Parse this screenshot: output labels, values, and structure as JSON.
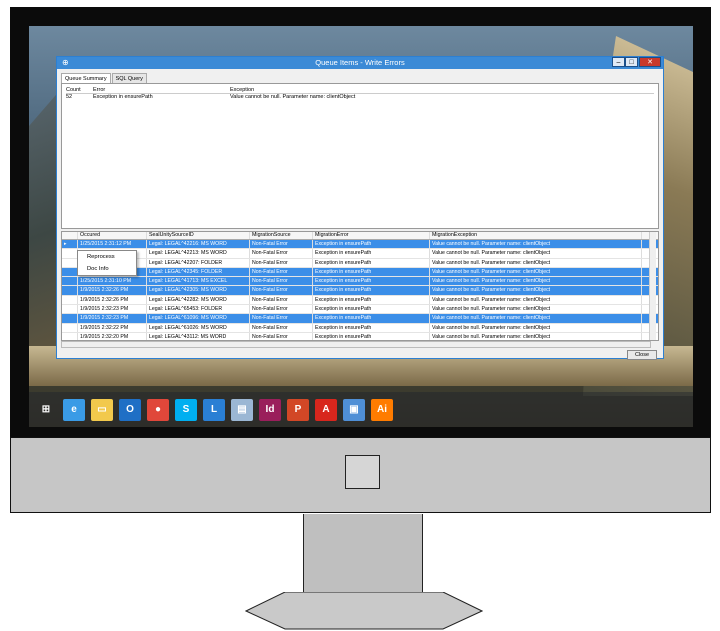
{
  "window": {
    "title": "Queue Items - Write Errors",
    "tabs": [
      "Queue Summary",
      "SQL Query"
    ],
    "close_label": "Close"
  },
  "summary": {
    "headers": [
      "Count",
      "Error",
      "Exception"
    ],
    "rows": [
      [
        "52",
        "Exception in ensurePath",
        "Value cannot be null. Parameter name: clientObject"
      ]
    ]
  },
  "grid": {
    "headers": [
      "Occured",
      "SealUnitySourceID",
      "MigrationSource",
      "MigrationError",
      "MigrationException"
    ],
    "rows": [
      {
        "occured": "1/25/2015 2:31:12 PM",
        "seal": "Legal: LEGAL^42216: MS WORD",
        "source": "Non-Fatal Error",
        "error": "Exception in ensurePath",
        "exception": "Value cannot be null. Parameter name: clientObject",
        "selected": true
      },
      {
        "occured": "1/25/2015 2:31:11 PM",
        "seal": "Legal: LEGAL^42213: MS WORD",
        "source": "Non-Fatal Error",
        "error": "Exception in ensurePath",
        "exception": "Value cannot be null. Parameter name: clientObject",
        "selected": false
      },
      {
        "occured": "1/25/2015 2:31:11 PM",
        "seal": "Legal: LEGAL^42207: FOLDER",
        "source": "Non-Fatal Error",
        "error": "Exception in ensurePath",
        "exception": "Value cannot be null. Parameter name: clientObject",
        "selected": false
      },
      {
        "occured": "1/25/2015 2:31:10 PM",
        "seal": "Legal: LEGAL^42345: FOLDER",
        "source": "Non-Fatal Error",
        "error": "Exception in ensurePath",
        "exception": "Value cannot be null. Parameter name: clientObject",
        "selected": true
      },
      {
        "occured": "1/25/2015 2:31:10 PM",
        "seal": "Legal: LEGAL^41713: MS EXCEL",
        "source": "Non-Fatal Error",
        "error": "Exception in ensurePath",
        "exception": "Value cannot be null. Parameter name: clientObject",
        "selected": true
      },
      {
        "occured": "1/9/2015 2:32:26 PM",
        "seal": "Legal: LEGAL^42305: MS WORD",
        "source": "Non-Fatal Error",
        "error": "Exception in ensurePath",
        "exception": "Value cannot be null. Parameter name: clientObject",
        "selected": true
      },
      {
        "occured": "1/9/2015 2:32:26 PM",
        "seal": "Legal: LEGAL^42282: MS WORD",
        "source": "Non-Fatal Error",
        "error": "Exception in ensurePath",
        "exception": "Value cannot be null. Parameter name: clientObject",
        "selected": false
      },
      {
        "occured": "1/9/2015 2:32:23 PM",
        "seal": "Legal: LEGAL^65453: FOLDER",
        "source": "Non-Fatal Error",
        "error": "Exception in ensurePath",
        "exception": "Value cannot be null. Parameter name: clientObject",
        "selected": false
      },
      {
        "occured": "1/9/2015 2:32:23 PM",
        "seal": "Legal: LEGAL^61096: MS WORD",
        "source": "Non-Fatal Error",
        "error": "Exception in ensurePath",
        "exception": "Value cannot be null. Parameter name: clientObject",
        "selected": true
      },
      {
        "occured": "1/9/2015 2:32:22 PM",
        "seal": "Legal: LEGAL^61026: MS WORD",
        "source": "Non-Fatal Error",
        "error": "Exception in ensurePath",
        "exception": "Value cannot be null. Parameter name: clientObject",
        "selected": false
      },
      {
        "occured": "1/9/2015 2:32:20 PM",
        "seal": "Legal: LEGAL^43112: MS WORD",
        "source": "Non-Fatal Error",
        "error": "Exception in ensurePath",
        "exception": "Value cannot be null. Parameter name: clientObject",
        "selected": false
      }
    ]
  },
  "context_menu": {
    "items": [
      "Reprocess",
      "Doc Info"
    ]
  },
  "taskbar": {
    "icons": [
      {
        "name": "windows-start-icon",
        "glyph": "⊞",
        "color": "#ffffff"
      },
      {
        "name": "internet-explorer-icon",
        "glyph": "e",
        "color": "#3a9be6"
      },
      {
        "name": "file-explorer-icon",
        "glyph": "▭",
        "color": "#f2c94c"
      },
      {
        "name": "outlook-icon",
        "glyph": "O",
        "color": "#1f6fc5"
      },
      {
        "name": "chrome-icon",
        "glyph": "●",
        "color": "#e0473a"
      },
      {
        "name": "skype-icon",
        "glyph": "S",
        "color": "#00aff0"
      },
      {
        "name": "lync-icon",
        "glyph": "L",
        "color": "#2a7fd4"
      },
      {
        "name": "notepad-icon",
        "glyph": "▤",
        "color": "#9bb7d4"
      },
      {
        "name": "indesign-icon",
        "glyph": "Id",
        "color": "#9a1f5b"
      },
      {
        "name": "powerpoint-icon",
        "glyph": "P",
        "color": "#d24726"
      },
      {
        "name": "acrobat-icon",
        "glyph": "A",
        "color": "#d8261d"
      },
      {
        "name": "remote-desktop-icon",
        "glyph": "▣",
        "color": "#4f8fd6"
      },
      {
        "name": "illustrator-icon",
        "glyph": "Ai",
        "color": "#ff7c00"
      }
    ]
  }
}
